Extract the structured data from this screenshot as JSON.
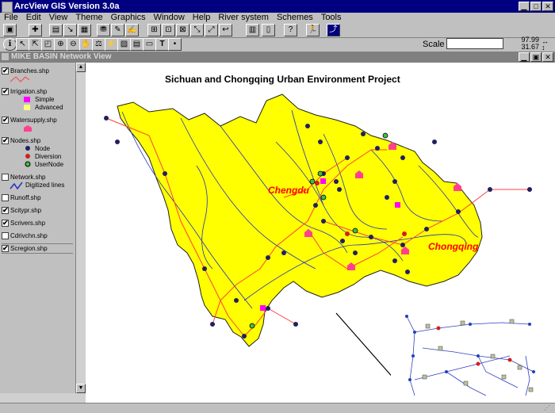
{
  "app": {
    "title": "ArcView GIS Version 3.0a"
  },
  "menu": [
    {
      "label": "File",
      "key": "F"
    },
    {
      "label": "Edit",
      "key": "E"
    },
    {
      "label": "View",
      "key": "V"
    },
    {
      "label": "Theme",
      "key": "T"
    },
    {
      "label": "Graphics",
      "key": "G"
    },
    {
      "label": "Window",
      "key": "W"
    },
    {
      "label": "Help",
      "key": "H"
    },
    {
      "label": "River system",
      "key": "R"
    },
    {
      "label": "Schemes",
      "key": "S"
    },
    {
      "label": "Tools",
      "key": "T"
    }
  ],
  "toolbar": {
    "scale_label": "Scale 1:",
    "scale_value": "",
    "coord_x": "97.99",
    "coord_y": "31.67"
  },
  "view": {
    "title": "MIKE BASIN Network View"
  },
  "toc": {
    "layers": [
      {
        "name": "Branches.shp",
        "checked": true
      },
      {
        "name": "Irrigation.shp",
        "checked": true,
        "legend": [
          "Simple",
          "Advanced"
        ]
      },
      {
        "name": "Watersupply.shp",
        "checked": true
      },
      {
        "name": "Nodes.shp",
        "checked": true,
        "legend": [
          "Node",
          "Diversion",
          "UserNode"
        ]
      },
      {
        "name": "Network.shp",
        "checked": false,
        "legend": [
          "Digitized lines"
        ]
      },
      {
        "name": "Runoff.shp",
        "checked": false
      },
      {
        "name": "Scitypr.shp",
        "checked": true
      },
      {
        "name": "Scrivers.shp",
        "checked": true
      },
      {
        "name": "Cdrivchn.shp",
        "checked": false
      },
      {
        "name": "Scregion.shp",
        "checked": true
      }
    ]
  },
  "map": {
    "title": "Sichuan and Chongqing Urban Environment Project",
    "labels": {
      "city1": "Chengdu",
      "city2": "Chongqing"
    }
  },
  "colors": {
    "titlebar": "#000080",
    "region": "#ffff00",
    "river": "#2030c0",
    "branch": "#ff4040",
    "node": "#202060",
    "label": "#ff0000"
  }
}
